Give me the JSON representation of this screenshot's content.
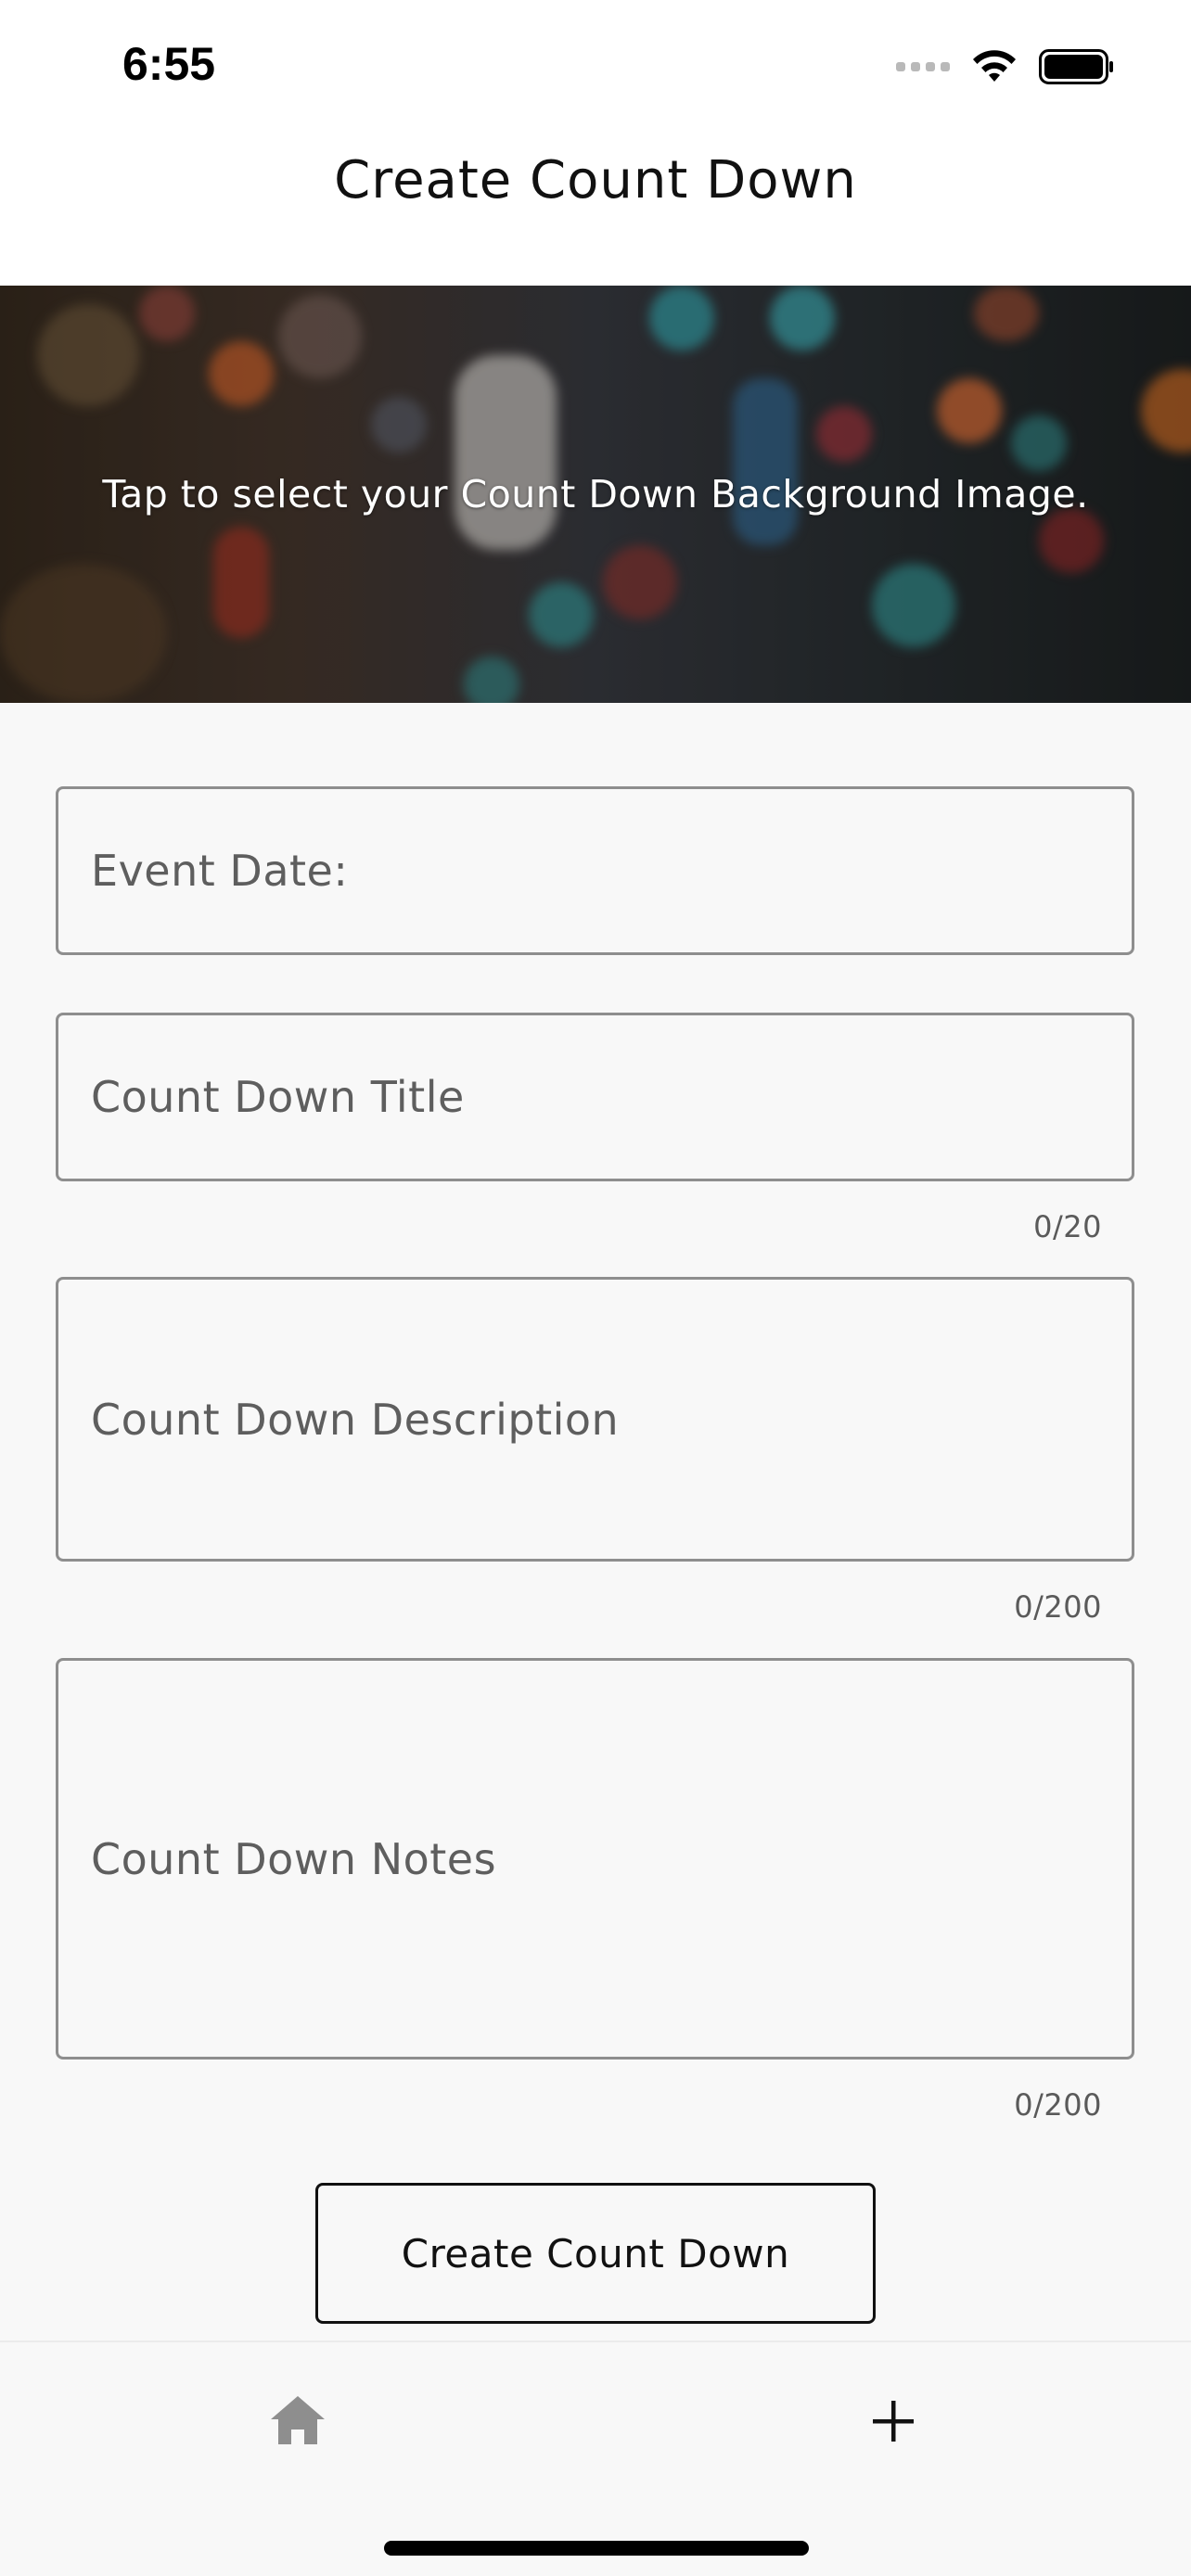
{
  "status_bar": {
    "time": "6:55"
  },
  "header": {
    "title": "Create Count Down"
  },
  "hero": {
    "prompt": "Tap to select your Count Down Background Image."
  },
  "form": {
    "event_date_label": "Event Date:",
    "title_label": "Count Down Title",
    "title_counter": "0/20",
    "description_label": "Count Down Description",
    "description_counter": "0/200",
    "notes_label": "Count Down Notes",
    "notes_counter": "0/200"
  },
  "submit": {
    "label": "Create Count Down"
  },
  "tab_bar": {
    "items": [
      {
        "icon": "home-icon",
        "active": false
      },
      {
        "icon": "plus-icon",
        "active": true
      }
    ]
  },
  "colors": {
    "background": "#f8f8f8",
    "field_border": "#8e8e8e",
    "tab_inactive": "#8e8e8e"
  }
}
